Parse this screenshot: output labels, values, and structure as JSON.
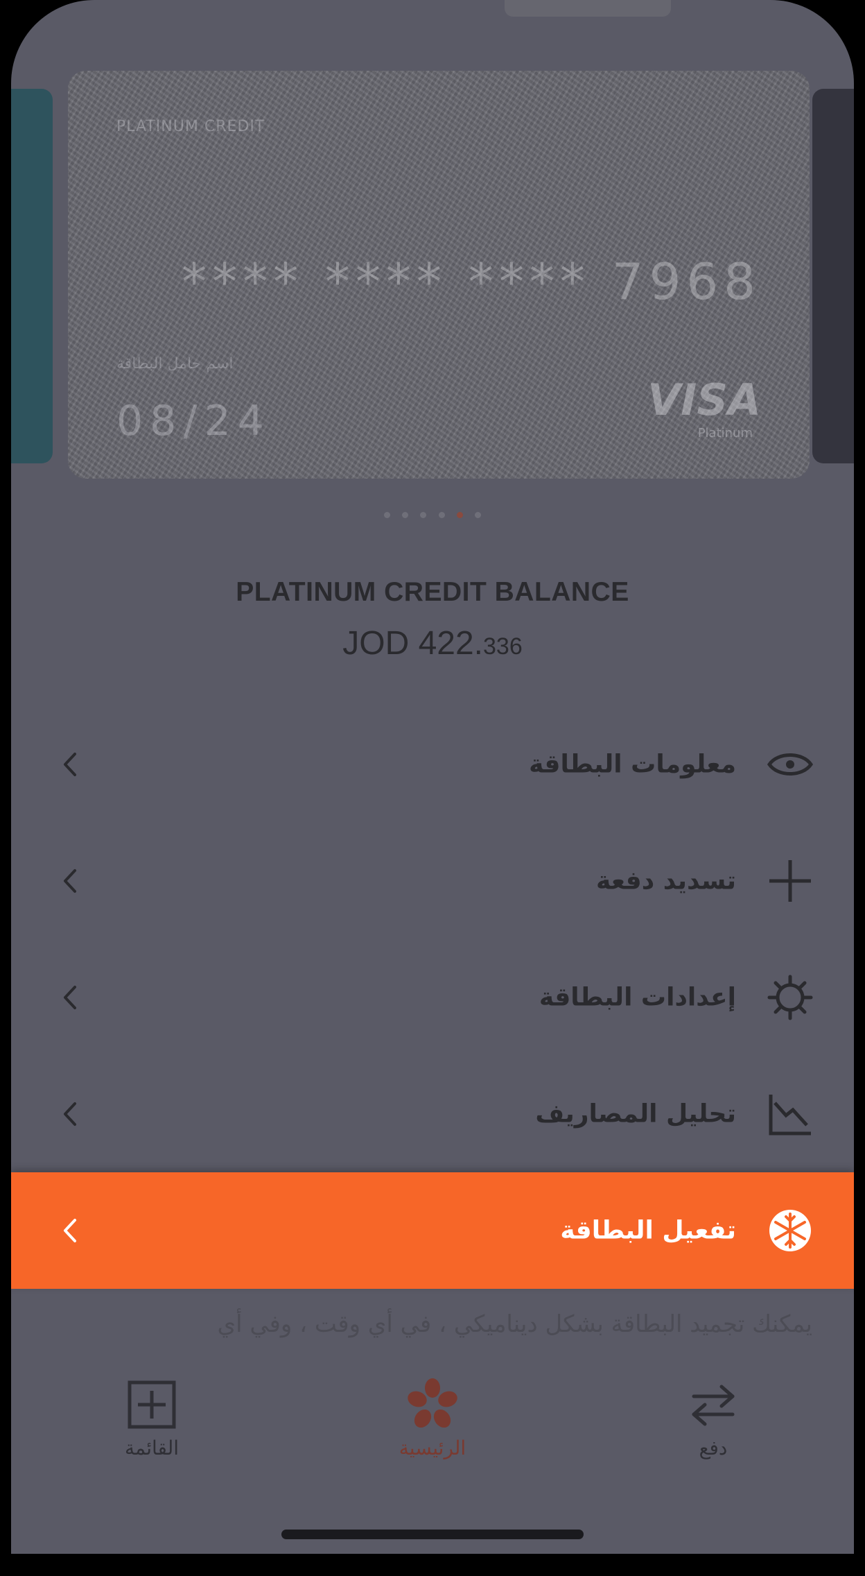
{
  "card": {
    "product_label": "PLATINUM CREDIT",
    "masked_number": "**** **** **** 7968",
    "holder_label": "اسم حامل البطاقة",
    "expiry": "08/24",
    "brand": "VISA",
    "brand_tier": "Platinum"
  },
  "carousel": {
    "page_count": 6,
    "active_index": 4
  },
  "balance": {
    "title": "PLATINUM CREDIT BALANCE",
    "currency": "JOD",
    "amount_main": "422.",
    "amount_fraction": "336"
  },
  "menu": [
    {
      "label": "معلومات البطاقة",
      "icon": "eye-icon"
    },
    {
      "label": "تسديد دفعة",
      "icon": "plus-icon"
    },
    {
      "label": "إعدادات البطاقة",
      "icon": "gear-icon"
    },
    {
      "label": "تحليل المصاريف",
      "icon": "chart-down-icon"
    },
    {
      "label": "تفعيل البطاقة",
      "icon": "snowflake-icon",
      "highlighted": true
    }
  ],
  "promo_text": "يمكنك تجميد البطاقة بشكل ديناميكي ، في أي وقت ، وفي أي",
  "bottom_nav": {
    "menu_label": "القائمة",
    "home_label": "الرئيسية",
    "pay_label": "دفع"
  },
  "colors": {
    "accent": "#f76628",
    "overlay_background": "#5a5a66",
    "home_active": "#7a3a30"
  }
}
